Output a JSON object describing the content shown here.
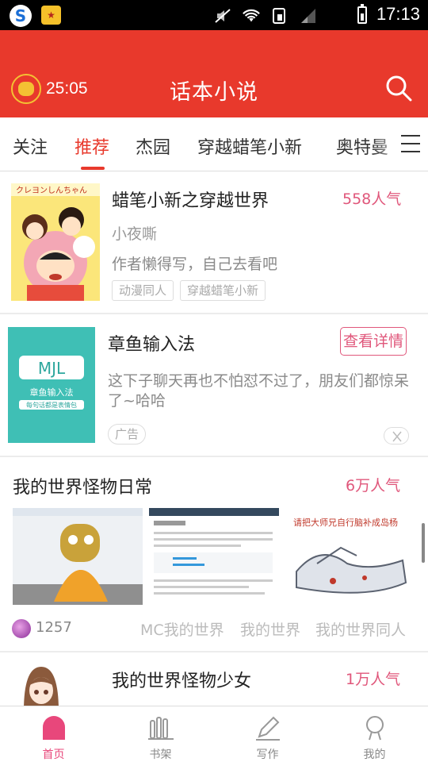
{
  "status_bar": {
    "time": "17:13",
    "app1_icon": "sogou-s-icon",
    "app2_icon": "gift-box-icon",
    "icons": [
      "mute-icon",
      "wifi-icon",
      "sim-icon",
      "signal-icon",
      "battery-icon"
    ]
  },
  "header": {
    "timer": "25:05",
    "title": "话本小说"
  },
  "tabs": [
    {
      "label": "关注",
      "active": false
    },
    {
      "label": "推荐",
      "active": true
    },
    {
      "label": "杰园",
      "active": false
    },
    {
      "label": "穿越蜡笔小新",
      "active": false
    },
    {
      "label": "奥特曼",
      "active": false
    }
  ],
  "feed": {
    "novel1": {
      "cover_text": "クレヨンしんちゃん",
      "title": "蜡笔小新之穿越世界",
      "popularity": "558人气",
      "author": "小夜嘶",
      "description": "作者懒得写，自己去看吧",
      "tags": [
        "动漫同人",
        "穿越蜡笔小新"
      ]
    },
    "ad": {
      "title": "章鱼输入法",
      "detail_label": "查看详情",
      "description": "这下子聊天再也不怕怼不过了，朋友们都惊呆了~哈哈",
      "ad_label": "广告",
      "image_caption": "章鱼输入法",
      "image_subcaption": "每句话都是表情包"
    },
    "novel2": {
      "title": "我的世界怪物日常",
      "popularity": "6万人气",
      "thumb_caption": "请把大师兄自行脑补成岛杨",
      "count": "1257",
      "tags": [
        "MC我的世界",
        "我的世界",
        "我的世界同人"
      ]
    },
    "novel3": {
      "title": "我的世界怪物少女",
      "popularity": "1万人气"
    }
  },
  "bottom_nav": [
    {
      "label": "首页",
      "icon": "home-icon",
      "active": true
    },
    {
      "label": "书架",
      "icon": "bookshelf-icon",
      "active": false
    },
    {
      "label": "写作",
      "icon": "pen-icon",
      "active": false
    },
    {
      "label": "我的",
      "icon": "profile-icon",
      "active": false
    }
  ],
  "colors": {
    "brand_red": "#e8392c",
    "popularity_pink": "#e0577b",
    "nav_active": "#e8477b"
  }
}
